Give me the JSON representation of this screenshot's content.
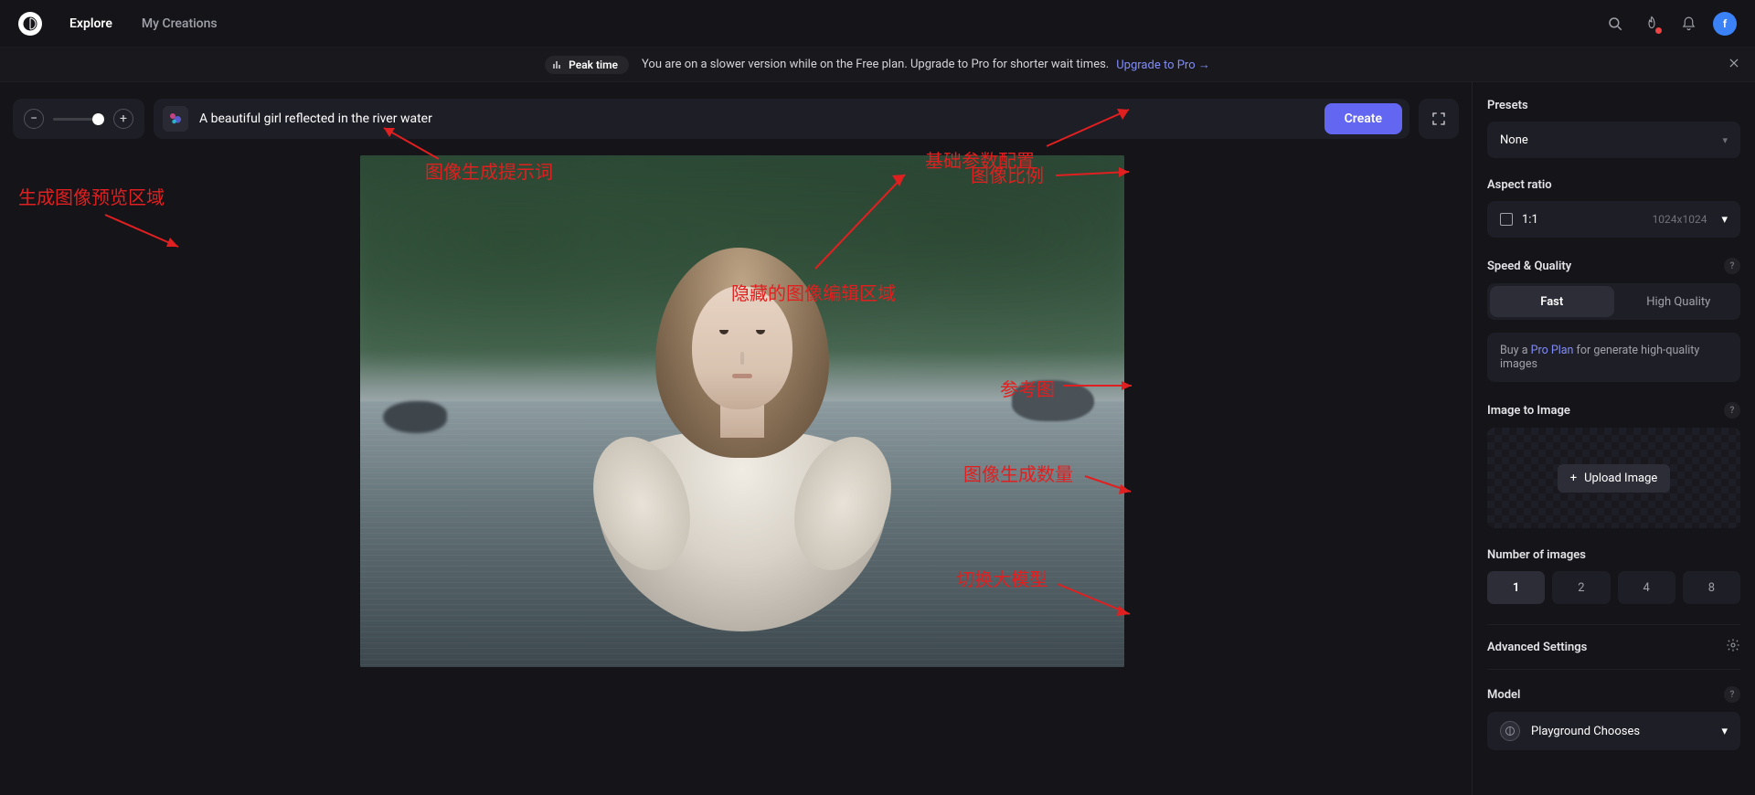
{
  "header": {
    "nav": {
      "explore": "Explore",
      "mycreations": "My Creations"
    },
    "avatar_initial": "f"
  },
  "banner": {
    "tag": "Peak time",
    "text": "You are on a slower version while on the Free plan. Upgrade to Pro for shorter wait times.",
    "link": "Upgrade to Pro →"
  },
  "prompt": {
    "value": "A beautiful girl reflected in the river water",
    "create": "Create"
  },
  "sidebar": {
    "presets": {
      "label": "Presets",
      "value": "None"
    },
    "aspect": {
      "label": "Aspect ratio",
      "ratio": "1:1",
      "dim": "1024x1024"
    },
    "speed": {
      "label": "Speed & Quality",
      "fast": "Fast",
      "hq": "High Quality"
    },
    "upsell": {
      "pre": "Buy a ",
      "link": "Pro Plan",
      "post": " for generate high-quality images"
    },
    "i2i": {
      "label": "Image to Image",
      "upload": "Upload Image"
    },
    "num": {
      "label": "Number of images",
      "opts": [
        "1",
        "2",
        "4",
        "8"
      ]
    },
    "advanced": "Advanced Settings",
    "model": {
      "label": "Model",
      "value": "Playground Chooses"
    }
  },
  "annotations": {
    "preview_area": "生成图像预览区域",
    "prompt_label": "图像生成提示词",
    "base_params": "基础参数配置",
    "aspect_label": "图像比例",
    "hidden_edit": "隐藏的图像编辑区域",
    "ref_image": "参考图",
    "num_images": "图像生成数量",
    "switch_model": "切换大模型"
  }
}
